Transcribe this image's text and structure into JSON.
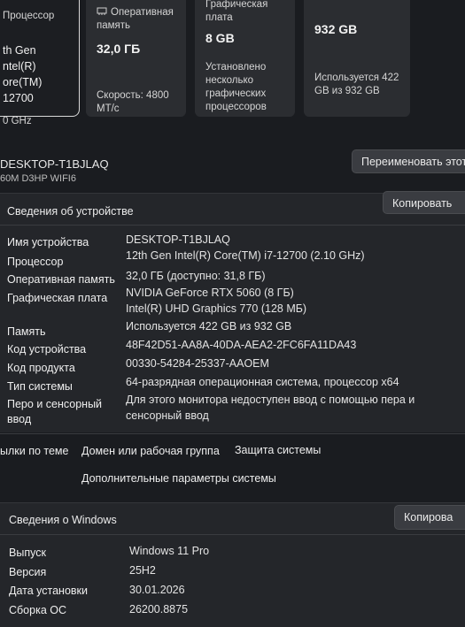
{
  "cards": {
    "processor": {
      "label": "Процессор",
      "lines": [
        "th Gen",
        "ntel(R)",
        "ore(TM)",
        "12700"
      ],
      "speed": "0 GHz"
    },
    "ram": {
      "label_line1": "Оперативная",
      "label_line2": "память",
      "value": "32,0 ГБ",
      "sub_line1": "Скорость: 4800",
      "sub_line2": "МТ/с"
    },
    "gpu": {
      "label_line1": "Графическая",
      "label_line2": "плата",
      "value": "8 GB",
      "sub": [
        "Установлено",
        "несколько",
        "графических",
        "процессоров"
      ]
    },
    "storage": {
      "value": "932 GB",
      "sub_line1": "Используется 422",
      "sub_line2": "GB из 932 GB"
    }
  },
  "header": {
    "device_name": "DESKTOP-T1BJLAQ",
    "model": "60M D3HP WIFI6",
    "rename_button": "Переименовать этот"
  },
  "device_specs": {
    "title": "Сведения об устройстве",
    "copy_button": "Копировать",
    "rows": [
      {
        "label": "Имя устройства",
        "value": "DESKTOP-T1BJLAQ"
      },
      {
        "label": "Процессор",
        "value": "12th Gen Intel(R) Core(TM) i7-12700 (2.10 GHz)"
      },
      {
        "label": "Оперативная память",
        "value": "32,0 ГБ (доступно: 31,8 ГБ)"
      },
      {
        "label": "Графическая плата",
        "value": "NVIDIA GeForce RTX 5060 (8 ГБ)",
        "value2": "Intel(R) UHD Graphics 770 (128 МБ)"
      },
      {
        "label": "Память",
        "value": "Используется 422 GB из 932 GB"
      },
      {
        "label": "Код устройства",
        "value": "48F42D51-AA8A-40DA-AEA2-2FC6FA11DA43"
      },
      {
        "label": "Код продукта",
        "value": "00330-54284-25337-AAOEM"
      },
      {
        "label": "Тип системы",
        "value": "64-разрядная операционная система, процессор x64"
      },
      {
        "label_line1": "Перо и сенсорный",
        "label_line2": "ввод",
        "value": "Для этого монитора недоступен ввод с помощью пера и",
        "value2": "сенсорный ввод"
      }
    ]
  },
  "related_links": {
    "items": [
      "ылки по теме",
      "Домен или рабочая группа",
      "Защита системы"
    ],
    "advanced": "Дополнительные параметры системы"
  },
  "windows_specs": {
    "title": "Сведения о Windows",
    "copy_button": "Копирова",
    "rows": [
      {
        "label": "Выпуск",
        "value": "Windows 11 Pro"
      },
      {
        "label": "Версия",
        "value": "25H2"
      },
      {
        "label": "Дата установки",
        "value": "30.01.2026"
      },
      {
        "label": "Сборка ОС",
        "value": "26200.8875"
      }
    ]
  }
}
